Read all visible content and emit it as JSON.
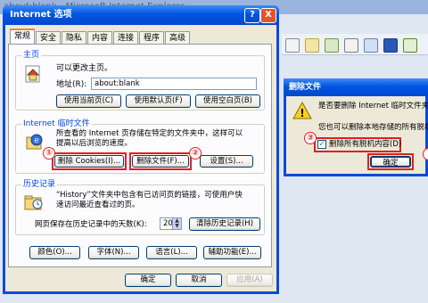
{
  "background": {
    "title": "about:blank - Microsoft Internet Explorer"
  },
  "dialog": {
    "title": "Internet 选项",
    "help": "?",
    "close": "X",
    "tabs": [
      "常规",
      "安全",
      "隐私",
      "内容",
      "连接",
      "程序",
      "高级"
    ],
    "home": {
      "group": "主页",
      "desc": "可以更改主页。",
      "address_label": "地址(R):",
      "address_value": "about:blank",
      "btn_current": "使用当前页(C)",
      "btn_default": "使用默认页(F)",
      "btn_blank": "使用空白页(B)"
    },
    "temp": {
      "group": "Internet 临时文件",
      "desc1": "所查看的 Internet 页存储在特定的文件夹中，这样可以",
      "desc2": "提高以后浏览的速度。",
      "btn_cookies": "删除 Cookies(I)...",
      "btn_files": "删除文件(F)...",
      "btn_settings": "设置(S)..."
    },
    "history": {
      "group": "历史记录",
      "desc1": "“History”文件夹中包含有已访问页的链接，可使用户快",
      "desc2": "速访问最近查看过的页。",
      "days_label": "网页保存在历史记录中的天数(K):",
      "days_value": "20",
      "btn_clear": "清除历史记录(H)"
    },
    "bottom_buttons": {
      "colors": "颜色(O)...",
      "fonts": "字体(N)...",
      "languages": "语言(L)...",
      "accessibility": "辅助功能(E)..."
    },
    "ok": "确定",
    "cancel": "取消",
    "apply": "应用(A)"
  },
  "delete_dialog": {
    "title": "删除文件",
    "msg1": "是否要删除 Internet 临时文件夹",
    "msg2": "您也可以删除本地存储的所有脱机",
    "checkbox_label": "删除所有脱机内容(D)",
    "ok": "确定"
  },
  "annotations": [
    "①",
    "②",
    "③"
  ],
  "colors": {
    "accent": "#0054e3",
    "highlight": "#e02020"
  }
}
